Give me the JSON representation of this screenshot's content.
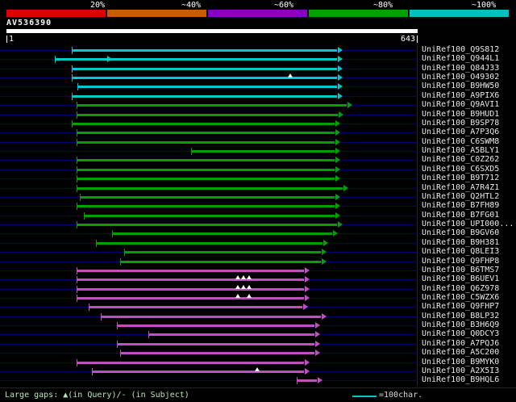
{
  "colors": {
    "background": "#000000",
    "row_line": "#000070",
    "bar_cyan": "#00c8c8",
    "bar_green": "#00a000",
    "bar_magenta": "#c050c0",
    "query_bar": "#ffffff",
    "text": "#ffffff",
    "footer_text": "#b8e8b8"
  },
  "legend": {
    "segments": [
      {
        "label": "20%",
        "color": "#dd0000"
      },
      {
        "label": "~40%",
        "color": "#c06000"
      },
      {
        "label": "~60%",
        "color": "#8800bb"
      },
      {
        "label": "~80%",
        "color": "#00a000"
      },
      {
        "label": "~100%",
        "color": "#00c0c0"
      }
    ],
    "label_x": [
      112,
      225,
      340,
      463,
      585
    ]
  },
  "query": {
    "name": "AV536390",
    "start_label": "1",
    "end_label": "643"
  },
  "chart_data": {
    "type": "alignment_overview",
    "title": "AV536390",
    "x_range": [
      1,
      643
    ],
    "legend_position": "top",
    "alignments": [
      {
        "id": "UniRef100_Q9S812",
        "color": "cyan",
        "start": 103,
        "end": 517
      },
      {
        "id": "UniRef100_Q944L1",
        "color": "cyan",
        "start": 76,
        "end": 517,
        "marks": [
          {
            "t": "arrow",
            "p": 158
          }
        ]
      },
      {
        "id": "UniRef100_Q84J33",
        "color": "cyan",
        "start": 103,
        "end": 517
      },
      {
        "id": "UniRef100_O49302",
        "color": "cyan",
        "start": 103,
        "end": 517,
        "marks": [
          {
            "t": "gap",
            "p": 444
          }
        ]
      },
      {
        "id": "UniRef100_B9HW50",
        "color": "cyan",
        "start": 112,
        "end": 517
      },
      {
        "id": "UniRef100_A9PIX6",
        "color": "cyan",
        "start": 103,
        "end": 517
      },
      {
        "id": "UniRef100_Q9AVI1",
        "color": "green",
        "start": 110,
        "end": 532
      },
      {
        "id": "UniRef100_B9HUD1",
        "color": "green",
        "start": 110,
        "end": 519
      },
      {
        "id": "UniRef100_B9SP78",
        "color": "green",
        "start": 103,
        "end": 513
      },
      {
        "id": "UniRef100_A7P3Q6",
        "color": "green",
        "start": 110,
        "end": 513
      },
      {
        "id": "UniRef100_C6SWM8",
        "color": "green",
        "start": 110,
        "end": 513
      },
      {
        "id": "UniRef100_A5BLY1",
        "color": "green",
        "start": 289,
        "end": 513
      },
      {
        "id": "UniRef100_C0Z262",
        "color": "green",
        "start": 110,
        "end": 513
      },
      {
        "id": "UniRef100_C6SXD5",
        "color": "green",
        "start": 110,
        "end": 513
      },
      {
        "id": "UniRef100_B9T712",
        "color": "green",
        "start": 110,
        "end": 513
      },
      {
        "id": "UniRef100_A7R4Z1",
        "color": "green",
        "start": 110,
        "end": 526
      },
      {
        "id": "UniRef100_Q2HTL2",
        "color": "green",
        "start": 116,
        "end": 513
      },
      {
        "id": "UniRef100_B7FH89",
        "color": "green",
        "start": 110,
        "end": 513
      },
      {
        "id": "UniRef100_B7FG01",
        "color": "green",
        "start": 122,
        "end": 513
      },
      {
        "id": "UniRef100_UPI000...",
        "color": "green",
        "start": 110,
        "end": 517
      },
      {
        "id": "UniRef100_B9GV60",
        "color": "green",
        "start": 166,
        "end": 509
      },
      {
        "id": "UniRef100_B9H381",
        "color": "green",
        "start": 141,
        "end": 494
      },
      {
        "id": "UniRef100_Q8LEI3",
        "color": "green",
        "start": 185,
        "end": 492
      },
      {
        "id": "UniRef100_Q9FHP8",
        "color": "green",
        "start": 179,
        "end": 492
      },
      {
        "id": "UniRef100_B6TMS7",
        "color": "magenta",
        "start": 110,
        "end": 466
      },
      {
        "id": "UniRef100_B6UEV1",
        "color": "magenta",
        "start": 110,
        "end": 466,
        "marks": [
          {
            "t": "gap",
            "p": 362
          },
          {
            "t": "gap",
            "p": 371
          },
          {
            "t": "gap",
            "p": 380
          }
        ]
      },
      {
        "id": "UniRef100_Q6Z978",
        "color": "magenta",
        "start": 110,
        "end": 466,
        "marks": [
          {
            "t": "gap",
            "p": 362
          },
          {
            "t": "gap",
            "p": 371
          },
          {
            "t": "gap",
            "p": 380
          }
        ]
      },
      {
        "id": "UniRef100_C5WZX6",
        "color": "magenta",
        "start": 110,
        "end": 466,
        "marks": [
          {
            "t": "gap",
            "p": 362
          },
          {
            "t": "gap",
            "p": 380
          }
        ]
      },
      {
        "id": "UniRef100_Q9FHP7",
        "color": "magenta",
        "start": 129,
        "end": 463
      },
      {
        "id": "UniRef100_B8LP32",
        "color": "magenta",
        "start": 148,
        "end": 492
      },
      {
        "id": "UniRef100_B3H6Q9",
        "color": "magenta",
        "start": 173,
        "end": 482
      },
      {
        "id": "UniRef100_Q0DCY3",
        "color": "magenta",
        "start": 223,
        "end": 482
      },
      {
        "id": "UniRef100_A7PQJ6",
        "color": "magenta",
        "start": 173,
        "end": 482
      },
      {
        "id": "UniRef100_A5C200",
        "color": "magenta",
        "start": 179,
        "end": 482
      },
      {
        "id": "UniRef100_B9MYK0",
        "color": "magenta",
        "start": 110,
        "end": 466
      },
      {
        "id": "UniRef100_A2X5I3",
        "color": "magenta",
        "start": 135,
        "end": 466,
        "marks": [
          {
            "t": "gap",
            "p": 393
          }
        ]
      },
      {
        "id": "UniRef100_B9HQL6",
        "color": "magenta",
        "start": 454,
        "end": 486
      }
    ]
  },
  "footer": {
    "gaps_legend": "Large gaps: ▲(in Query)/- (in Subject)",
    "scale_label": "=100char."
  }
}
